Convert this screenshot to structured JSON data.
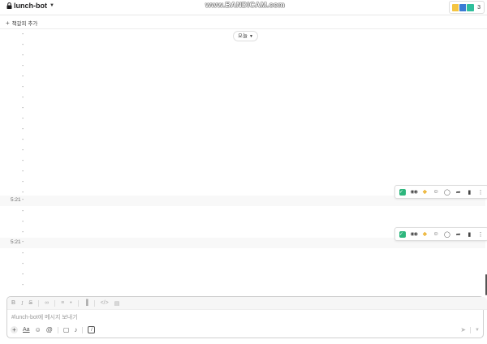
{
  "header": {
    "channel_name": "lunch-bot",
    "watermark": "www.BANDICAM.com",
    "member_count": "3",
    "avatar_colors": [
      "#f4c542",
      "#3a7bd5",
      "#2fbf9b"
    ]
  },
  "bookmarks": {
    "add_label": "책갈피 추가"
  },
  "divider": {
    "date_label": "오늘"
  },
  "messages": {
    "dash": "-",
    "timestamps": [
      "5:21",
      "5:21"
    ]
  },
  "composer": {
    "placeholder": "#lunch-bot에 메시지 보내기",
    "format_buttons": [
      "bold-icon",
      "italic-icon",
      "strikethrough-icon",
      "link-icon",
      "ordered-list-icon",
      "bulleted-list-icon",
      "blockquote-icon",
      "code-icon",
      "code-block-icon"
    ],
    "action_buttons": [
      "plus-icon",
      "format-toggle-icon",
      "emoji-icon",
      "mention-icon",
      "video-icon",
      "microphone-icon",
      "slash-command-icon"
    ],
    "format_toggle_label": "Aa"
  },
  "hover_toolbar": {
    "reactions": [
      "white-check-mark",
      "eyes",
      "raised-hands"
    ],
    "buttons": [
      "add-reaction-icon",
      "reply-thread-icon",
      "share-icon",
      "bookmark-icon",
      "more-actions-icon"
    ]
  },
  "colors": {
    "check_green": "#2eb67d",
    "hands_yellow": "#e8a100",
    "row_highlight": "#f8f8f8"
  }
}
